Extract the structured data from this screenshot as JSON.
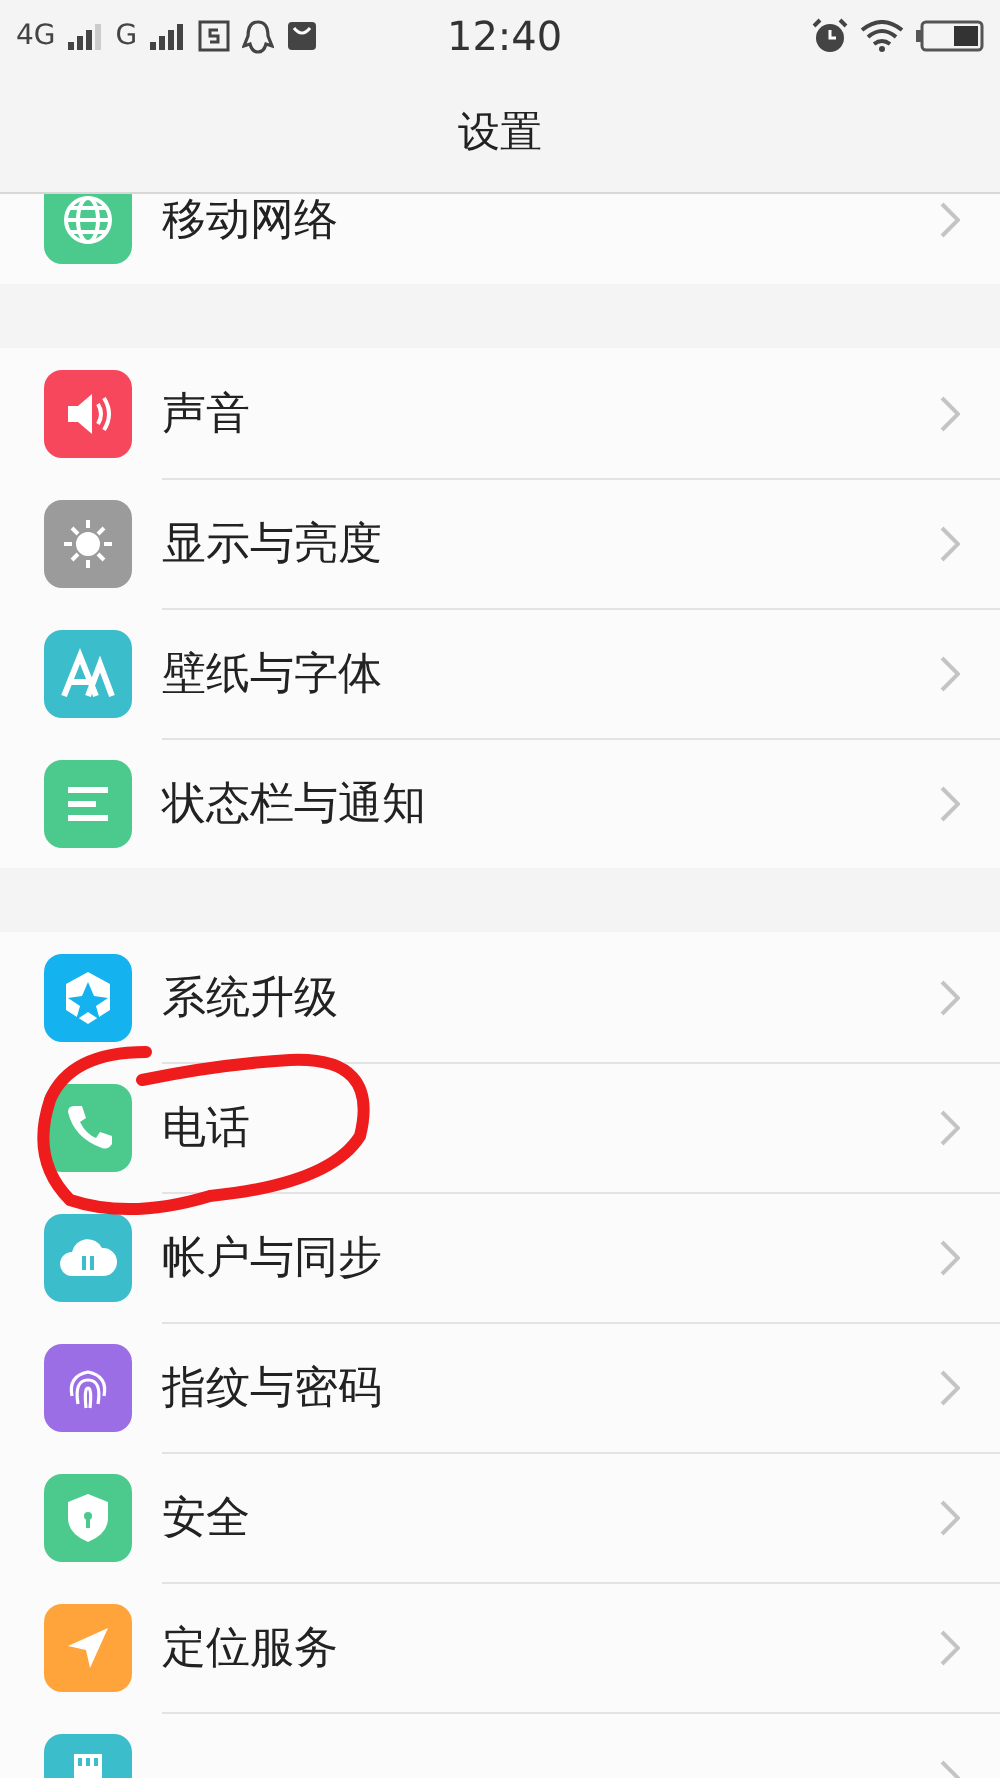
{
  "status_bar": {
    "network_1": "4G",
    "network_2": "G",
    "time": "12:40"
  },
  "header": {
    "title": "设置"
  },
  "sections": [
    {
      "items": [
        {
          "label": "移动网络",
          "kind": "globe",
          "color": "#4cc98d"
        }
      ]
    },
    {
      "items": [
        {
          "label": "声音",
          "kind": "speaker",
          "color": "#f6475c"
        },
        {
          "label": "显示与亮度",
          "kind": "sun",
          "color": "#9b9b9b"
        },
        {
          "label": "壁纸与字体",
          "kind": "letters",
          "color": "#3cbdcb"
        },
        {
          "label": "状态栏与通知",
          "kind": "lines",
          "color": "#4cc98d"
        }
      ]
    },
    {
      "items": [
        {
          "label": "系统升级",
          "kind": "cube",
          "color": "#14b2ee"
        },
        {
          "label": "电话",
          "kind": "phone",
          "color": "#4cc98d"
        },
        {
          "label": "帐户与同步",
          "kind": "cloud",
          "color": "#3cbdcb"
        },
        {
          "label": "指纹与密码",
          "kind": "fingerprint",
          "color": "#9c6ee6"
        },
        {
          "label": "安全",
          "kind": "shield",
          "color": "#4cc98d"
        },
        {
          "label": "定位服务",
          "kind": "location",
          "color": "#ffa43a"
        },
        {
          "kind": "card",
          "color": "#3cbdcb"
        }
      ]
    }
  ]
}
